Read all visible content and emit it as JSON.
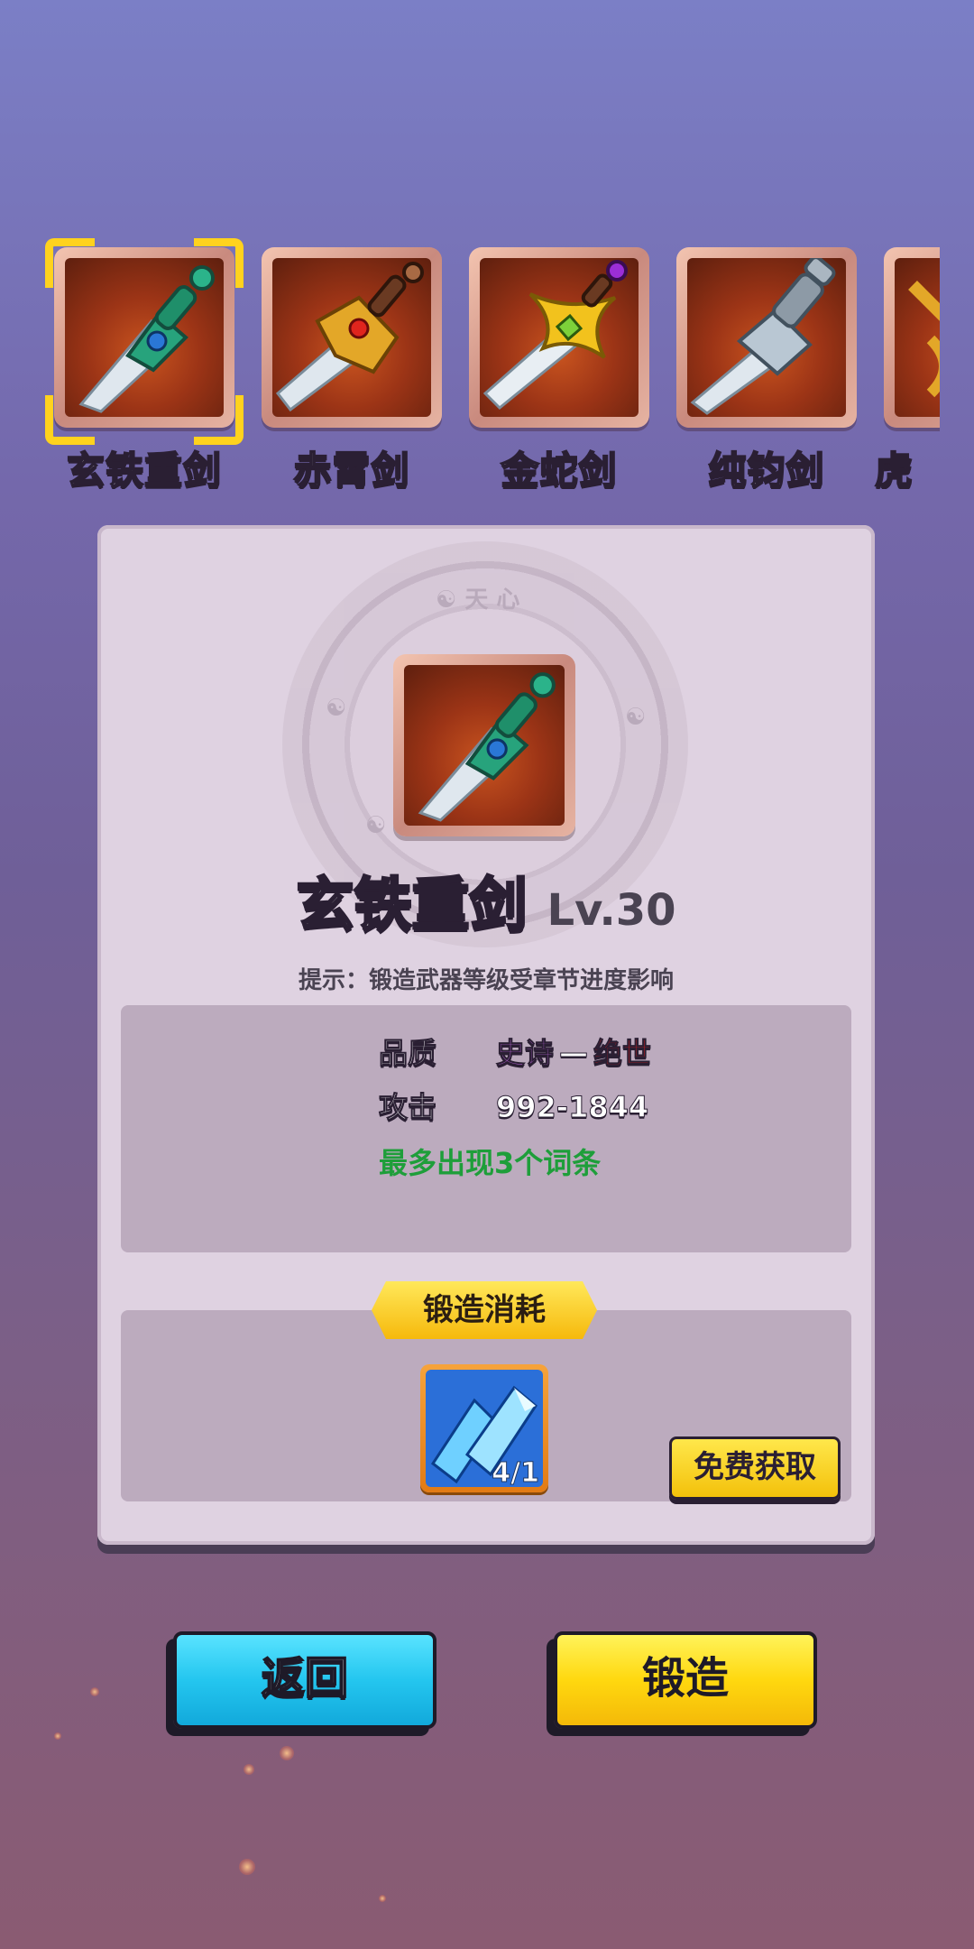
{
  "weapons": [
    {
      "name": "玄铁重剑",
      "selected": true
    },
    {
      "name": "赤霄剑",
      "selected": false
    },
    {
      "name": "金蛇剑",
      "selected": false
    },
    {
      "name": "纯钧剑",
      "selected": false
    },
    {
      "name": "虎",
      "selected": false
    }
  ],
  "detail": {
    "name": "玄铁重剑",
    "level": "Lv.30",
    "hint": "提示：锻造武器等级受章节进度影响",
    "quality_label": "品质",
    "quality_low": "史诗",
    "quality_sep": "—",
    "quality_high": "绝世",
    "attack_label": "攻击",
    "attack_value": "992-1844",
    "affix_note": "最多出现3个词条"
  },
  "cost": {
    "title": "锻造消耗",
    "item_count": "4/1",
    "free_button": "免费获取"
  },
  "buttons": {
    "back": "返回",
    "forge": "锻造"
  },
  "colors": {
    "epic": "#c56ae6",
    "legendary": "#e31b1b",
    "affix": "#1e9e3a",
    "select": "#ffd21e"
  }
}
